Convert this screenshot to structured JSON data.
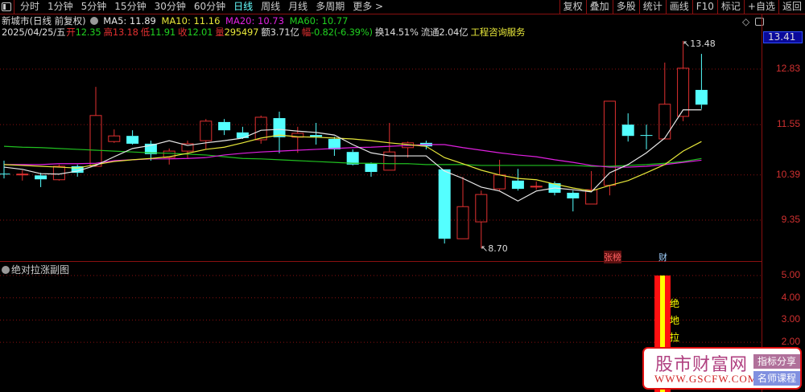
{
  "toolbar": {
    "tabs": [
      "分时",
      "1分钟",
      "5分钟",
      "15分钟",
      "30分钟",
      "60分钟",
      "日线",
      "周线",
      "月线",
      "多周期",
      "更多 >"
    ],
    "active": "日线",
    "right_buttons": [
      "复权",
      "叠加",
      "多股",
      "统计",
      "画线",
      "F10",
      "标记",
      "+自选",
      "返回"
    ]
  },
  "info": {
    "name": "新城市(日线 前复权)",
    "ma5": "MA5: 11.89",
    "ma10": "MA10: 11.16",
    "ma20": "MA20: 10.73",
    "ma60": "MA60: 10.77",
    "date": "2025/04/25/五",
    "open_l": "开",
    "open": "12.35",
    "high_l": "高",
    "high": "13.18",
    "low_l": "低",
    "low": "11.91",
    "close_l": "收",
    "close": "12.01",
    "vol_l": "量",
    "vol": "295497",
    "amt": "额3.71亿",
    "chg_l": "幅",
    "chg": "-0.82(-6.39%)",
    "turn": "换14.51%",
    "float": "流通2.04亿",
    "industry": "工程咨询服务"
  },
  "colors": {
    "up": "#e03030",
    "down": "#54ffff",
    "ma5": "#e8e8e8",
    "ma10": "#e8e83a",
    "ma20": "#e020e0",
    "ma60": "#20c020",
    "grid": "#8a1010"
  },
  "axis": {
    "current": "13.41",
    "ticks": [
      "12.83",
      "11.55",
      "10.39",
      "9.35"
    ],
    "sub_ticks": [
      "5.00",
      "4.00",
      "3.00",
      "2.00"
    ]
  },
  "markers": {
    "high": "13.48",
    "low": "8.70",
    "tag1": "张榜",
    "tag2": "财"
  },
  "sub": {
    "title": "绝对拉涨副图",
    "signal_chars": [
      "绝",
      "地",
      "拉"
    ],
    "signal_value": 5
  },
  "chart_data": {
    "type": "candlestick",
    "ylim": [
      8.4,
      13.7
    ],
    "ohlc": [
      [
        10.42,
        10.72,
        10.31,
        10.41
      ],
      [
        10.4,
        10.5,
        10.26,
        10.41
      ],
      [
        10.38,
        10.44,
        10.11,
        10.29
      ],
      [
        10.28,
        10.63,
        10.26,
        10.59
      ],
      [
        10.59,
        10.63,
        10.35,
        10.44
      ],
      [
        10.59,
        12.42,
        10.59,
        11.76
      ],
      [
        11.16,
        11.44,
        11.13,
        11.29
      ],
      [
        11.29,
        11.42,
        11.09,
        11.11
      ],
      [
        11.11,
        11.18,
        10.72,
        10.87
      ],
      [
        10.79,
        11.0,
        10.63,
        10.94
      ],
      [
        10.94,
        11.18,
        10.77,
        11.11
      ],
      [
        11.18,
        11.68,
        10.98,
        11.63
      ],
      [
        11.61,
        11.68,
        11.31,
        11.42
      ],
      [
        11.37,
        11.5,
        11.22,
        11.24
      ],
      [
        11.2,
        11.76,
        11.11,
        11.72
      ],
      [
        11.7,
        11.85,
        10.89,
        11.26
      ],
      [
        11.26,
        11.5,
        10.9,
        11.35
      ],
      [
        11.31,
        11.59,
        11.09,
        11.27
      ],
      [
        11.22,
        11.27,
        10.83,
        10.98
      ],
      [
        10.92,
        10.98,
        10.61,
        10.63
      ],
      [
        10.65,
        10.68,
        10.35,
        10.46
      ],
      [
        10.5,
        11.59,
        10.5,
        10.92
      ],
      [
        11.02,
        11.16,
        10.79,
        11.13
      ],
      [
        11.13,
        11.18,
        10.98,
        11.05
      ],
      [
        10.52,
        10.52,
        8.81,
        8.92
      ],
      [
        8.92,
        10.35,
        8.92,
        9.66
      ],
      [
        9.31,
        10.03,
        8.7,
        9.94
      ],
      [
        10.07,
        10.74,
        10.03,
        10.39
      ],
      [
        10.26,
        10.53,
        10.03,
        10.07
      ],
      [
        10.12,
        10.24,
        10.05,
        10.13
      ],
      [
        10.2,
        10.24,
        9.92,
        9.98
      ],
      [
        9.98,
        10.03,
        9.55,
        9.85
      ],
      [
        9.72,
        10.48,
        9.72,
        10.05
      ],
      [
        10.15,
        12.09,
        9.92,
        12.09
      ],
      [
        11.55,
        11.81,
        11.16,
        11.29
      ],
      [
        11.31,
        11.55,
        10.98,
        11.3
      ],
      [
        11.22,
        12.98,
        11.22,
        12.02
      ],
      [
        11.74,
        13.48,
        11.63,
        12.85
      ],
      [
        12.35,
        13.18,
        11.91,
        12.01
      ]
    ],
    "ma5": [
      10.57,
      10.52,
      10.42,
      10.41,
      10.48,
      10.61,
      10.81,
      11.0,
      11.07,
      11.18,
      11.07,
      11.13,
      11.18,
      11.24,
      11.42,
      11.44,
      11.4,
      11.37,
      11.31,
      11.09,
      10.9,
      10.83,
      10.83,
      10.83,
      10.48,
      10.31,
      10.11,
      10.02,
      9.79,
      10.02,
      10.09,
      10.05,
      10.0,
      10.44,
      10.63,
      10.9,
      11.24,
      11.89,
      11.89
    ],
    "ma10": [
      10.63,
      10.61,
      10.59,
      10.57,
      10.55,
      10.63,
      10.7,
      10.74,
      10.77,
      10.81,
      10.89,
      10.98,
      11.03,
      11.13,
      11.24,
      11.31,
      11.27,
      11.26,
      11.24,
      11.22,
      11.18,
      11.13,
      11.09,
      11.05,
      10.79,
      10.65,
      10.5,
      10.39,
      10.31,
      10.28,
      10.18,
      10.09,
      10.02,
      10.15,
      10.26,
      10.44,
      10.63,
      10.94,
      11.16
    ],
    "ma20": [
      10.63,
      10.63,
      10.63,
      10.65,
      10.65,
      10.66,
      10.72,
      10.74,
      10.76,
      10.76,
      10.77,
      10.79,
      10.85,
      10.89,
      10.92,
      10.94,
      10.96,
      10.98,
      11.0,
      11.02,
      11.03,
      11.05,
      11.07,
      11.09,
      11.09,
      11.02,
      10.96,
      10.9,
      10.85,
      10.81,
      10.74,
      10.68,
      10.61,
      10.57,
      10.57,
      10.59,
      10.63,
      10.68,
      10.73
    ],
    "ma60": [
      11.05,
      11.03,
      11.02,
      11.0,
      10.98,
      10.96,
      10.94,
      10.92,
      10.9,
      10.89,
      10.87,
      10.85,
      10.81,
      10.77,
      10.76,
      10.74,
      10.72,
      10.7,
      10.68,
      10.66,
      10.66,
      10.65,
      10.65,
      10.63,
      10.63,
      10.63,
      10.61,
      10.61,
      10.61,
      10.61,
      10.61,
      10.61,
      10.59,
      10.59,
      10.61,
      10.63,
      10.66,
      10.7,
      10.77
    ]
  },
  "watermark": {
    "name": "股市财富网",
    "url": "WWW.GSCFW.COM",
    "badge1": "指标分享",
    "badge2": "名师课程"
  }
}
